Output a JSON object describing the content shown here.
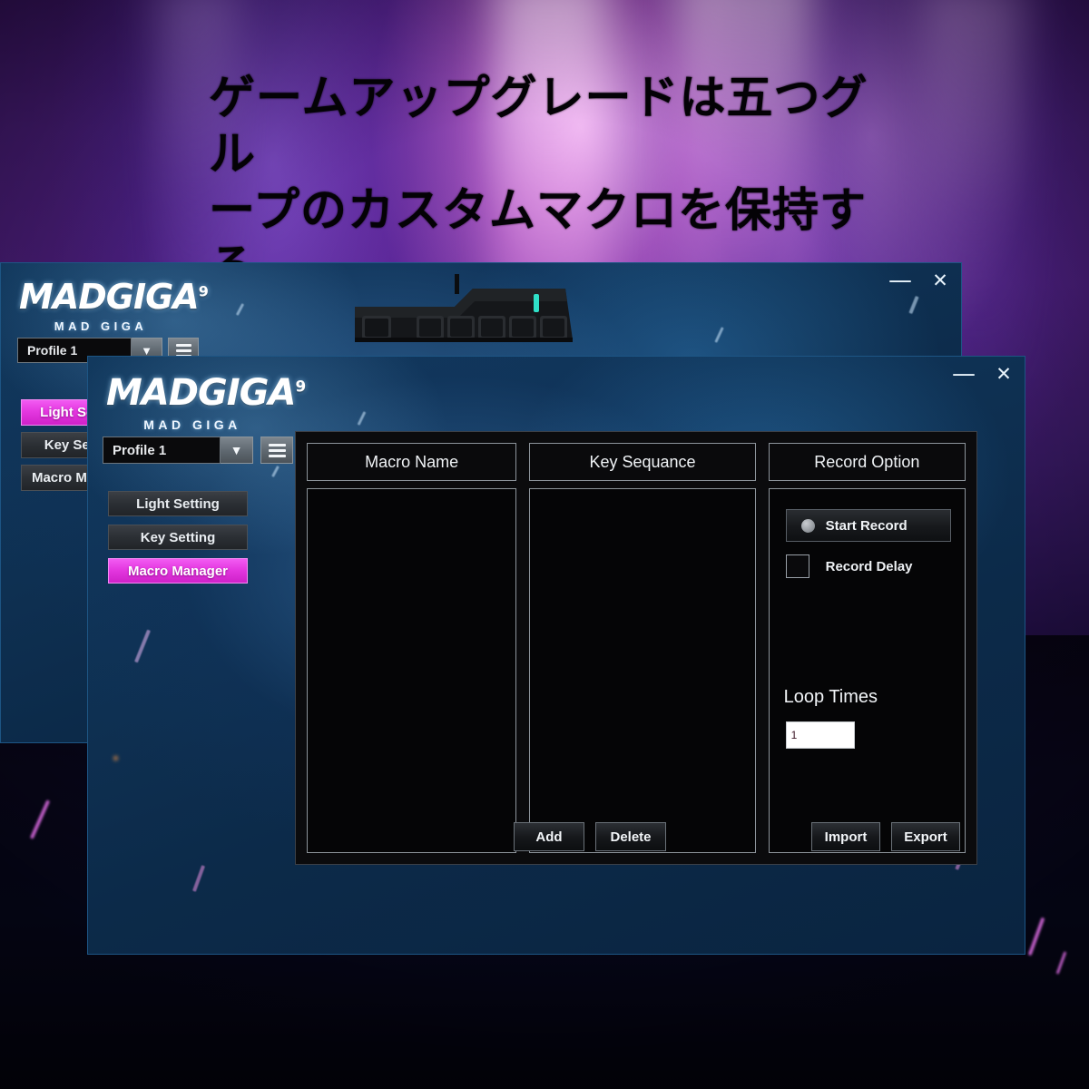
{
  "headline": {
    "text": "ゲームアップグレードは五つグル\nープのカスタムマクロを保持する",
    "color": "#040206"
  },
  "theme": {
    "accent_magenta": "#e438e0",
    "window_blue": "#0f3356",
    "panel_black": "#0b0b0d",
    "border_gray": "#8d949b",
    "text_white": "#f0f3f6"
  },
  "back_window": {
    "logo": {
      "mark": "MADGIGA",
      "superscript": "9",
      "subtitle": "MAD GIGA"
    },
    "profile": {
      "value": "Profile 1",
      "dropdown_icon": "chevron-down-icon",
      "menu_icon": "hamburger-menu-icon"
    },
    "nav": [
      {
        "label": "Light Setting",
        "active": true
      },
      {
        "label": "Key Setting",
        "active": false
      },
      {
        "label": "Macro Manager",
        "active": false
      }
    ],
    "controls": {
      "minimize": "—",
      "close": "✕"
    }
  },
  "front_window": {
    "logo": {
      "mark": "MADGIGA",
      "superscript": "9",
      "subtitle": "MAD GIGA"
    },
    "profile": {
      "value": "Profile 1",
      "dropdown_icon": "chevron-down-icon",
      "menu_icon": "hamburger-menu-icon"
    },
    "nav": [
      {
        "label": "Light Setting",
        "active": false
      },
      {
        "label": "Key Setting",
        "active": false
      },
      {
        "label": "Macro Manager",
        "active": true
      }
    ],
    "controls": {
      "minimize": "—",
      "close": "✕"
    },
    "columns": {
      "macro_name": {
        "header": "Macro Name",
        "rows": []
      },
      "key_sequence": {
        "header": "Key Sequance",
        "rows": []
      },
      "record_option": {
        "header": "Record Option"
      }
    },
    "record_option": {
      "start_record_label": "Start Record",
      "record_delay_label": "Record Delay",
      "record_delay_checked": false,
      "loop_times_label": "Loop Times",
      "loop_times_value": "1"
    },
    "footer": {
      "add_label": "Add",
      "delete_label": "Delete",
      "import_label": "Import",
      "export_label": "Export"
    }
  }
}
